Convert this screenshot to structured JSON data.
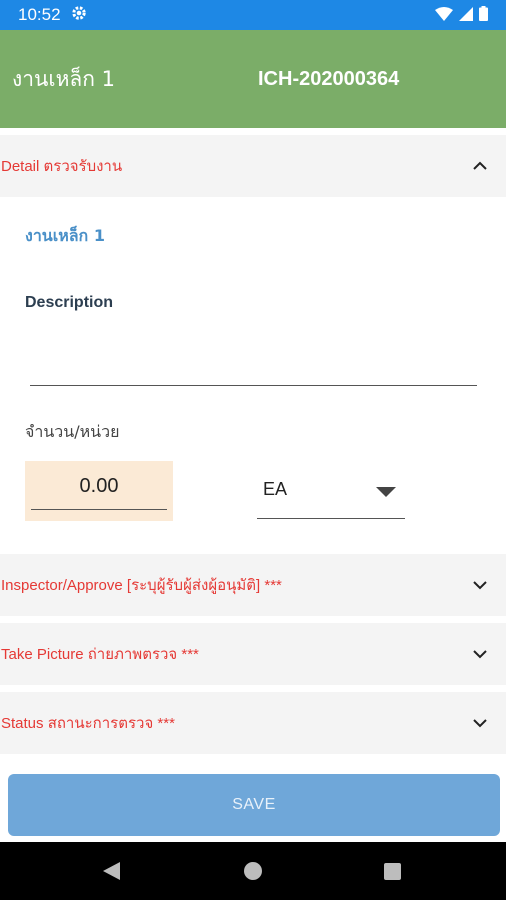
{
  "status_bar": {
    "time": "10:52",
    "icons": [
      "gear-icon",
      "wifi-icon",
      "signal-icon",
      "battery-icon"
    ]
  },
  "header": {
    "left_title": "งานเหล็ก 1",
    "right_title": "ICH-202000364",
    "color": "#7bad68"
  },
  "detail_section": {
    "title": "Detail ตรวจรับงาน",
    "expanded": true,
    "item_name": "งานเหล็ก 1",
    "description_label": "Description",
    "description_value": "",
    "quantity_label": "จำนวน/หน่วย",
    "quantity_value": "0.00",
    "unit_value": "EA"
  },
  "sections": [
    {
      "title": "Inspector/Approve [ระบุผู้รับผู้ส่งผู้อนุมัติ] ***",
      "expanded": false
    },
    {
      "title": "Take Picture ถ่ายภาพตรวจ ***",
      "expanded": false
    },
    {
      "title": "Status สถานะการตรวจ ***",
      "expanded": false
    }
  ],
  "save_button": {
    "label": "SAVE"
  },
  "colors": {
    "status_bar": "#1e88e5",
    "accent_red": "#e53935",
    "save_button": "#6fa7d9",
    "quantity_bg": "#fbead6"
  }
}
